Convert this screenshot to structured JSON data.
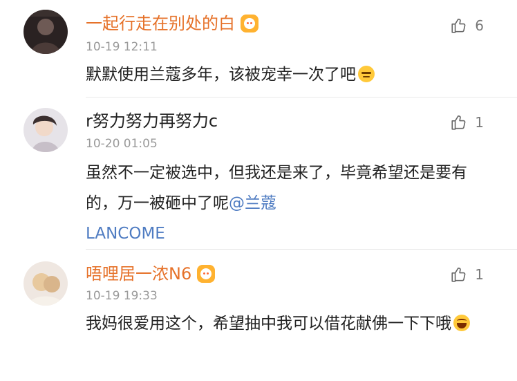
{
  "comments": [
    {
      "username": "一起行走在别处的白",
      "time": "10-19 12:11",
      "text": "默默使用兰蔻多年，该被宠幸一次了吧",
      "mention": "",
      "mention2": "",
      "likes": "6",
      "emoji": "sweat-emoji",
      "badge": "vip-badge"
    },
    {
      "username": "r努力努力再努力c",
      "time": "10-20 01:05",
      "text": "虽然不一定被选中，但我还是来了，毕竟希望还是要有的，万一被砸中了呢",
      "mention": "@兰蔻",
      "mention2": "LANCOME",
      "likes": "1",
      "emoji": "",
      "badge": ""
    },
    {
      "username": "唔哩居一浓N6",
      "time": "10-19 19:33",
      "text": "我妈很爱用这个，希望抽中我可以借花献佛一下下哦",
      "mention": "",
      "mention2": "",
      "likes": "1",
      "emoji": "laugh-emoji",
      "badge": "vip-badge"
    }
  ],
  "colors": {
    "vip_name": "#e6722a",
    "plain_name": "#222222",
    "mention": "#4f7cc2",
    "time": "#9a9a9a",
    "like": "#777777"
  },
  "icons": [
    "thumbs-up-icon",
    "vip-badge-icon",
    "sweat-emoji",
    "laugh-emoji",
    "avatar"
  ]
}
